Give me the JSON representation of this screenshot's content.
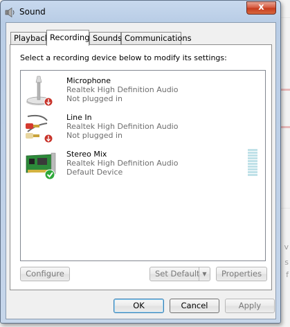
{
  "window": {
    "title": "Sound",
    "close_label": "x"
  },
  "tabs": [
    {
      "label": "Playback",
      "active": false
    },
    {
      "label": "Recording",
      "active": true
    },
    {
      "label": "Sounds",
      "active": false
    },
    {
      "label": "Communications",
      "active": false
    }
  ],
  "instruction": "Select a recording device below to modify its settings:",
  "devices": [
    {
      "name": "Microphone",
      "description": "Realtek High Definition Audio",
      "status": "Not plugged in",
      "icon": "microphone-icon"
    },
    {
      "name": "Line In",
      "description": "Realtek High Definition Audio",
      "status": "Not plugged in",
      "icon": "line-in-cable-icon"
    },
    {
      "name": "Stereo Mix",
      "description": "Realtek High Definition Audio",
      "status": "Default Device",
      "icon": "sound-card-icon"
    }
  ],
  "buttons": {
    "configure": "Configure",
    "set_default": "Set Default",
    "properties": "Properties",
    "ok": "OK",
    "cancel": "Cancel",
    "apply": "Apply"
  },
  "background": {
    "text_v": "v",
    "text_s": "s",
    "text_f": "f"
  },
  "colors": {
    "default_check": "#2fa83a",
    "unplugged_badge": "#c8342b",
    "level_meter": "#bfe1e8"
  }
}
